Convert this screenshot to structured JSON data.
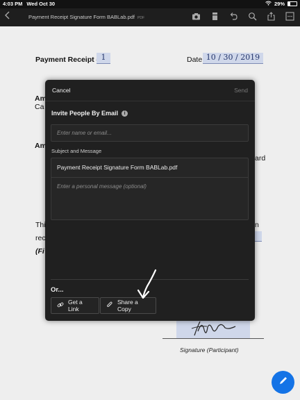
{
  "status_bar": {
    "time": "4:03 PM",
    "date": "Wed Oct 30",
    "battery": "29%"
  },
  "toolbar": {
    "title": "Payment Receipt Signature Form BABLab.pdf",
    "ext": "PDF",
    "icons": [
      "back-icon",
      "camera-icon",
      "bookmark-icon",
      "undo-icon",
      "search-icon",
      "share-icon",
      "more-icon"
    ]
  },
  "document": {
    "receipt_label": "Payment Receipt #",
    "receipt_value": "1",
    "date_label": "Date:",
    "date_value": "10 / 30 / 2019",
    "frag_am1": "Am",
    "frag_ca": "Ca",
    "frag_am2": "Am",
    "frag_ard": "ard",
    "frag_thi": "Thi",
    "frag_n": "n",
    "frag_rec": "rec",
    "frag_fi": "(Fi",
    "signature_label": "Signature (Participant)"
  },
  "dialog": {
    "cancel": "Cancel",
    "send": "Send",
    "invite_title": "Invite People By Email",
    "email_placeholder": "Enter name or email...",
    "subject_label": "Subject and Message",
    "subject_value": "Payment Receipt Signature Form BABLab.pdf",
    "message_placeholder": "Enter a personal message (optional)",
    "or_label": "Or...",
    "get_link": "Get a Link",
    "share_copy": "Share a Copy"
  },
  "colors": {
    "accent": "#1473e6",
    "dialog_bg": "#202020",
    "toolbar_bg": "#1e1e1e"
  }
}
